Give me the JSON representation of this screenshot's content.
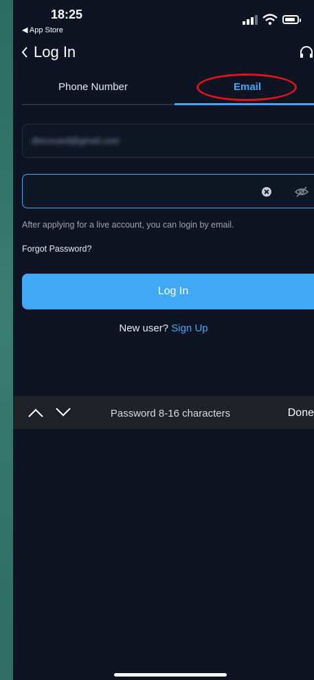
{
  "status_bar": {
    "time": "18:25",
    "back_app": "◀ App Store",
    "icons": [
      "signal-icon",
      "wifi-icon",
      "battery-icon"
    ]
  },
  "nav": {
    "back_label": "Log In",
    "icons": [
      "chevron-left-icon",
      "headset-icon"
    ]
  },
  "tabs": [
    {
      "label": "Phone Number",
      "active": false
    },
    {
      "label": "Email",
      "active": true
    }
  ],
  "form": {
    "email_value": "discocard@gmail.com",
    "password_value": "",
    "hint": "After applying for a live account, you can login by email.",
    "forgot": "Forgot Password?",
    "login_button": "Log In",
    "new_user": "New user?",
    "sign_up": "Sign Up"
  },
  "keyboard_toolbar": {
    "title": "Password 8-16 characters",
    "done": "Done",
    "icons": [
      "chevron-up-icon",
      "chevron-down-icon"
    ]
  },
  "colors": {
    "accent": "#3fa9f5",
    "background": "#0e1422",
    "annotation": "#e3131b"
  }
}
